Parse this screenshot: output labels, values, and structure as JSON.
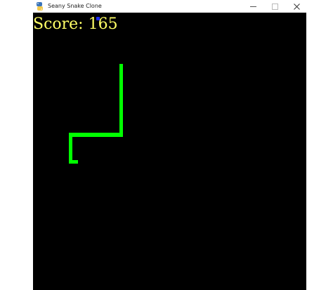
{
  "window": {
    "title": "Seany Snake Clone",
    "icons": {
      "app": "python-icon",
      "minimize": "minimize-icon",
      "maximize": "maximize-icon",
      "close": "close-icon"
    }
  },
  "game": {
    "score_text": "Score: 165",
    "colors": {
      "background": "#000000",
      "snake": "#00ff00",
      "score": "#ffff66",
      "food": "#1c2cff"
    }
  }
}
